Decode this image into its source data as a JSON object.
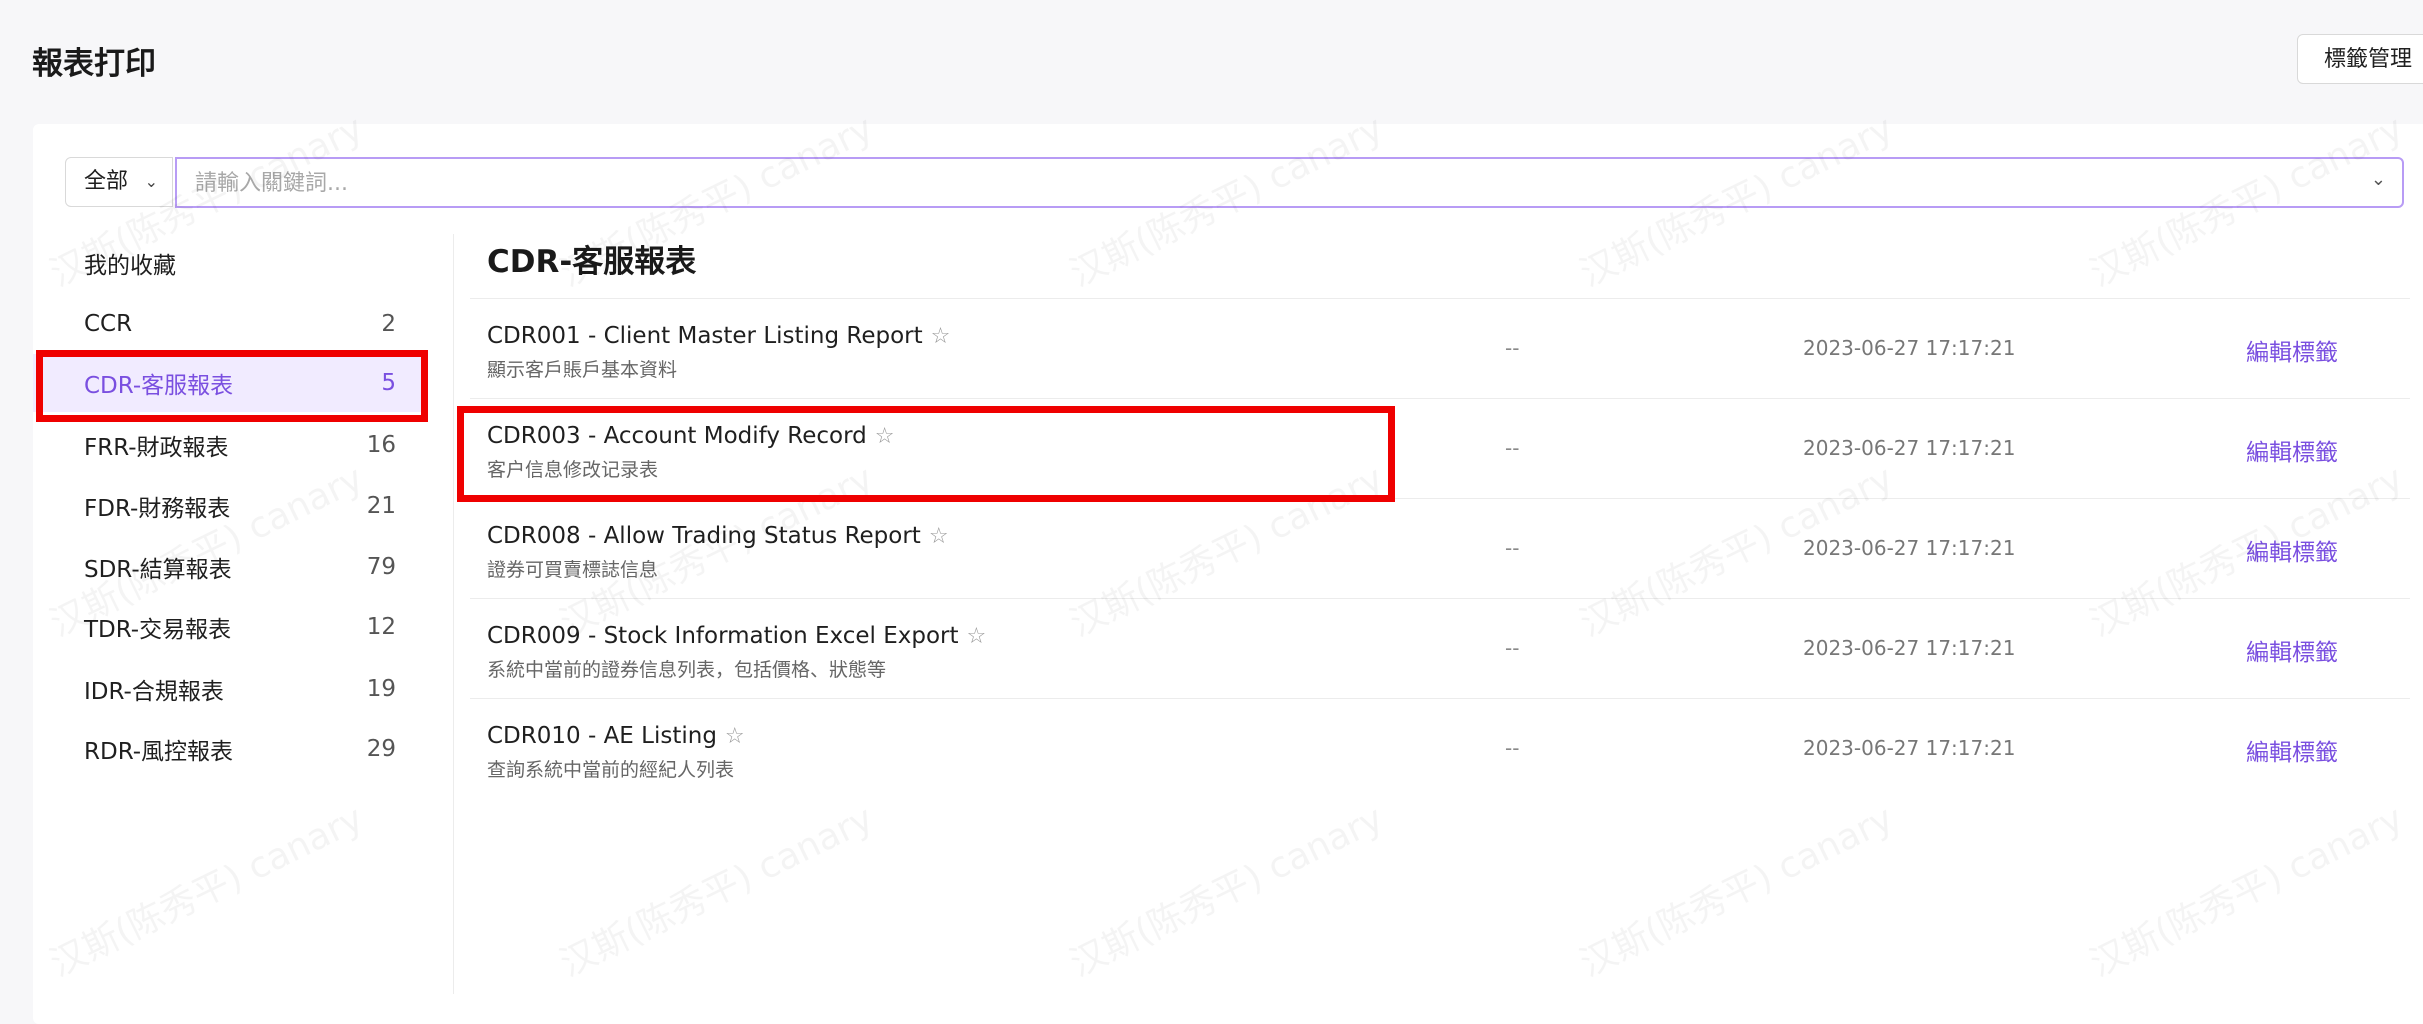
{
  "page": {
    "title": "報表打印",
    "tag_manage_label": "標籤管理"
  },
  "search": {
    "scope": "全部",
    "placeholder": "請輸入關鍵詞..."
  },
  "watermark": "汉斯(陈秀平) canary",
  "sidebar": {
    "items": [
      {
        "label": "我的收藏",
        "count": ""
      },
      {
        "label": "CCR",
        "count": "2"
      },
      {
        "label": "CDR-客服報表",
        "count": "5",
        "active": true
      },
      {
        "label": "FRR-財政報表",
        "count": "16"
      },
      {
        "label": "FDR-財務報表",
        "count": "21"
      },
      {
        "label": "SDR-結算報表",
        "count": "79"
      },
      {
        "label": "TDR-交易報表",
        "count": "12"
      },
      {
        "label": "IDR-合規報表",
        "count": "19"
      },
      {
        "label": "RDR-風控報表",
        "count": "29"
      }
    ]
  },
  "main": {
    "section_title": "CDR-客服報表",
    "edit_label": "編輯標籤",
    "reports": [
      {
        "name": "CDR001 - Client Master Listing Report",
        "desc": "顯示客戶賬戶基本資料",
        "tags": "--",
        "time": "2023-06-27 17:17:21"
      },
      {
        "name": "CDR003 - Account Modify Record",
        "desc": "客户信息修改记录表",
        "tags": "--",
        "time": "2023-06-27 17:17:21"
      },
      {
        "name": "CDR008 - Allow Trading Status Report",
        "desc": "證券可買賣標誌信息",
        "tags": "--",
        "time": "2023-06-27 17:17:21"
      },
      {
        "name": "CDR009 - Stock Information Excel Export",
        "desc": "系統中當前的證券信息列表，包括價格、狀態等",
        "tags": "--",
        "time": "2023-06-27 17:17:21"
      },
      {
        "name": "CDR010 - AE Listing",
        "desc": "查詢系統中當前的經紀人列表",
        "tags": "--",
        "time": "2023-06-27 17:17:21"
      }
    ]
  },
  "colors": {
    "accent": "#7a4fe0",
    "highlight": "#ef0000",
    "active_bg": "#f1ebff"
  }
}
